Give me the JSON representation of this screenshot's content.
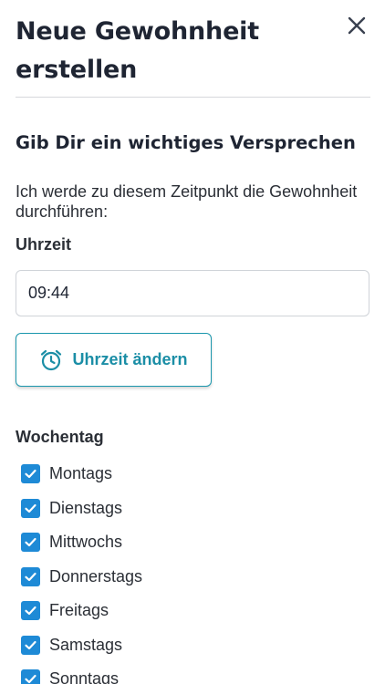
{
  "header": {
    "title_line1": "Neue Gewohnheit",
    "title_line2": "erstellen"
  },
  "section": {
    "subtitle": "Gib Dir ein wichtiges Versprechen",
    "description": "Ich werde zu diesem Zeitpunkt die Gewohnheit durchführen:"
  },
  "time": {
    "label": "Uhrzeit",
    "value": "09:44",
    "change_button_label": "Uhrzeit ändern"
  },
  "weekdays": {
    "label": "Wochentag",
    "items": [
      {
        "label": "Montags",
        "checked": true
      },
      {
        "label": "Dienstags",
        "checked": true
      },
      {
        "label": "Mittwochs",
        "checked": true
      },
      {
        "label": "Donnerstags",
        "checked": true
      },
      {
        "label": "Freitags",
        "checked": true
      },
      {
        "label": "Samstags",
        "checked": true
      },
      {
        "label": "Sonntags",
        "checked": true
      }
    ]
  },
  "colors": {
    "accent": "#1b97ad",
    "checkbox": "#1e8ad6",
    "text": "#1f2533"
  },
  "icons": {
    "close": "close-icon",
    "alarm": "alarm-clock-icon",
    "check": "checkmark-icon"
  }
}
